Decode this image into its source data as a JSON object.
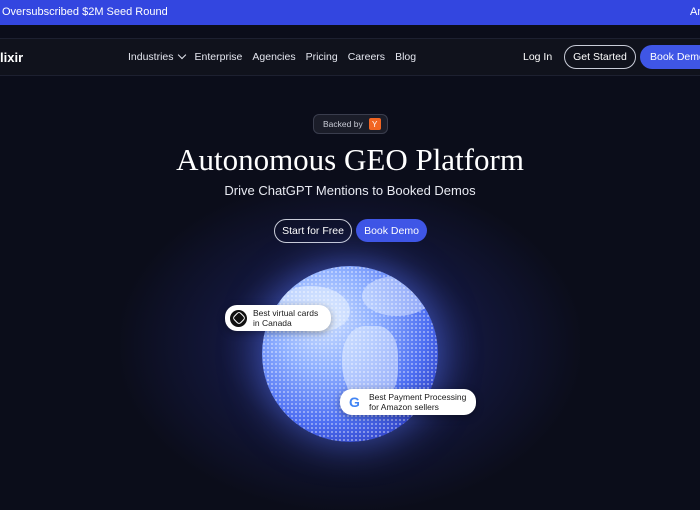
{
  "announcement": {
    "text": "Oversubscribed $2M Seed Round",
    "text_right": "An"
  },
  "nav": {
    "logo": "lixir",
    "links": [
      "Industries",
      "Enterprise",
      "Agencies",
      "Pricing",
      "Careers",
      "Blog"
    ],
    "login": "Log In",
    "get_started": "Get Started",
    "book_demo": "Book Demo"
  },
  "hero": {
    "backed_label": "Backed by",
    "backer_logo": "Y",
    "title": "Autonomous GEO Platform",
    "subtitle": "Drive ChatGPT Mentions to Booked Demos",
    "cta_primary": "Start for Free",
    "cta_secondary": "Book Demo"
  },
  "badges": [
    {
      "icon": "chatgpt-icon",
      "line1": "Best virtual cards",
      "line2": "in Canada"
    },
    {
      "icon": "google-icon",
      "line1": "Best Payment Processing",
      "line2": "for Amazon sellers"
    }
  ],
  "colors": {
    "accent": "#3f56e6",
    "announce_bar": "#3346e0",
    "background": "#0b0d1a"
  }
}
